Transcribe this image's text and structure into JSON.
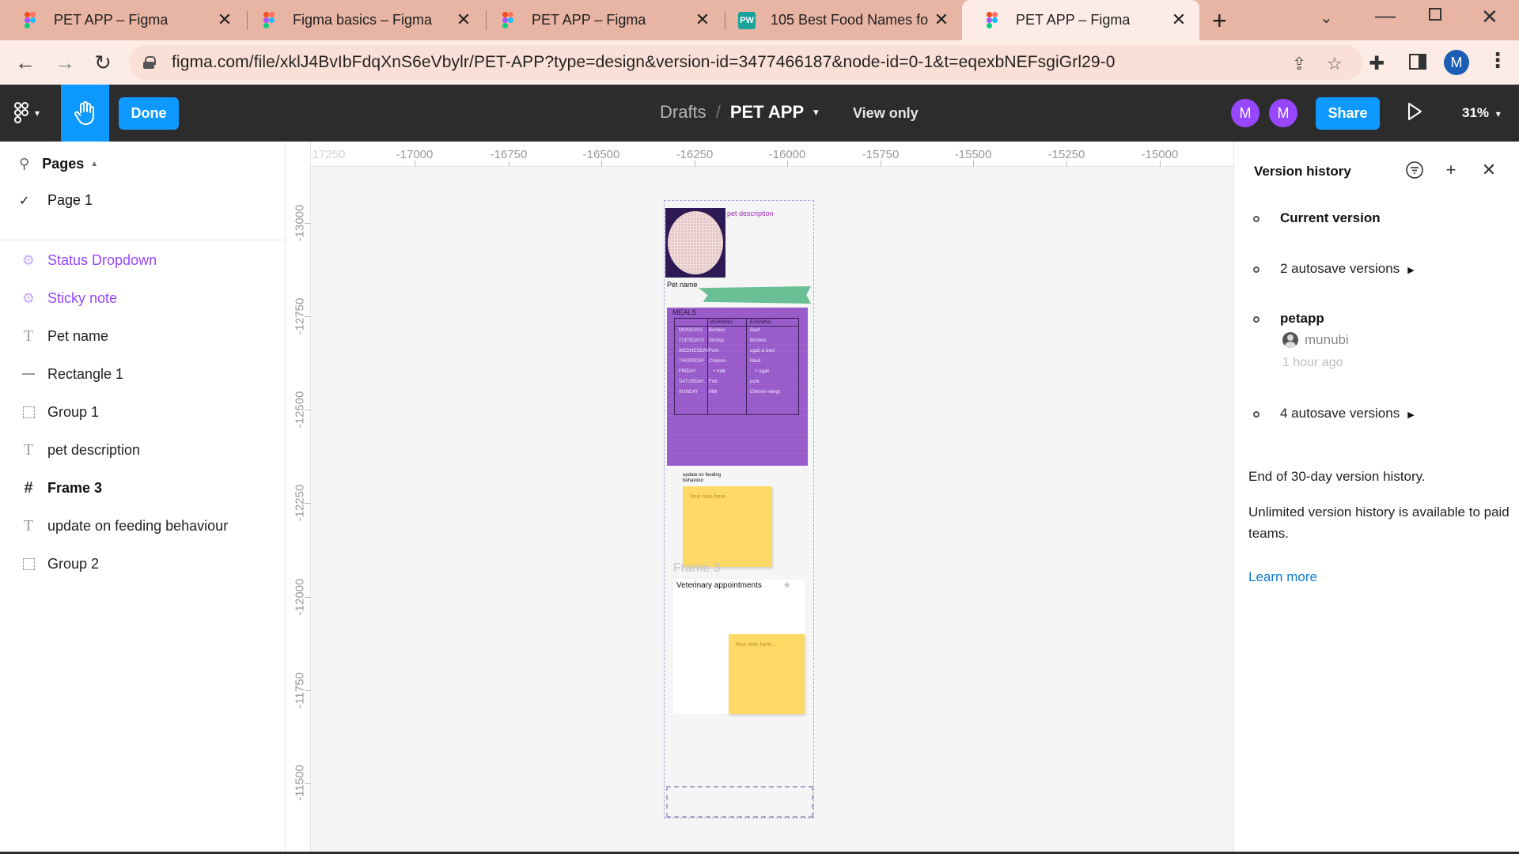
{
  "browser": {
    "tabs": [
      {
        "label": "PET APP – Figma",
        "icon": "figma-icon"
      },
      {
        "label": "Figma basics – Figma",
        "icon": "figma-icon"
      },
      {
        "label": "PET APP – Figma",
        "icon": "figma-icon"
      },
      {
        "label": "105 Best Food Names for",
        "icon": "pw-icon",
        "icon_text": "PW"
      },
      {
        "label": "PET APP – Figma",
        "icon": "figma-icon",
        "active": true
      }
    ],
    "url": "figma.com/file/xklJ4BvIbFdqXnS6eVbylr/PET-APP?type=design&version-id=3477466187&node-id=0-1&t=eqexbNEFsgiGrl29-0",
    "profile_initial": "M",
    "colors": {
      "tabbar": "#e8b4a3",
      "toolbar": "#fdece6"
    }
  },
  "figma_toolbar": {
    "done_label": "Done",
    "breadcrumb_drafts": "Drafts",
    "breadcrumb_sep": "/",
    "file_name": "PET APP",
    "view_only": "View only",
    "avatars": [
      "M",
      "M"
    ],
    "share_label": "Share",
    "zoom": "31%",
    "accent": "#0d99ff",
    "avatar_color": "#9747ff"
  },
  "left_panel": {
    "pages_label": "Pages",
    "current_page": "Page 1",
    "layers": [
      {
        "label": "Status Dropdown",
        "type": "component"
      },
      {
        "label": "Sticky note",
        "type": "component"
      },
      {
        "label": "Pet name",
        "type": "text"
      },
      {
        "label": "Rectangle 1",
        "type": "rectangle"
      },
      {
        "label": "Group 1",
        "type": "group"
      },
      {
        "label": "pet description",
        "type": "text"
      },
      {
        "label": "Frame 3",
        "type": "frame"
      },
      {
        "label": "update on feeding behaviour",
        "type": "text"
      },
      {
        "label": "Group 2",
        "type": "group"
      }
    ]
  },
  "canvas": {
    "ruler_x": [
      "-17250",
      "-17000",
      "-16750",
      "-16500",
      "-16250",
      "-16000",
      "-15750",
      "-15500",
      "-15250",
      "-15000"
    ],
    "ruler_y": [
      "-13000",
      "-12750",
      "-12500",
      "-12250",
      "-12000",
      "-11750",
      "-11500"
    ],
    "pet_description": "pet description",
    "pet_name": "Pet name",
    "meals_title": "MEALS",
    "meals_headers": [
      "MORNING",
      "EVENING"
    ],
    "meals_rows": [
      {
        "day": "MONDAYS",
        "morning": "Bonbon",
        "evening": "Beef"
      },
      {
        "day": "TUESDAYS",
        "morning": "Shrimp",
        "evening": "Bonbon"
      },
      {
        "day": "WEDNESDAY",
        "morning": "Pork",
        "evening": "ugali & beef"
      },
      {
        "day": "THURSDAY",
        "morning": "Chicken",
        "evening": "Meat"
      },
      {
        "day": "FRIDAY",
        "morning": "+ milk",
        "evening": "+ ugali"
      },
      {
        "day": "SATURDAY",
        "morning": "Fish",
        "evening": "pork"
      },
      {
        "day": "SUNDAY",
        "morning": "Milk",
        "evening": "Chicken wings"
      }
    ],
    "feeding_label": "update on feeding behaviour",
    "sticky_placeholder": "Your note here...",
    "frame_label": "Frame 3",
    "vet_title": "Veterinary appointments"
  },
  "version_history": {
    "title": "Version history",
    "entries": [
      {
        "label": "Current version"
      },
      {
        "label": "2 autosave versions"
      },
      {
        "label": "petapp",
        "user": "munubi",
        "time": "1 hour ago"
      },
      {
        "label": "4 autosave versions"
      }
    ],
    "end_note": "End of 30-day version history.",
    "unlimited_note": "Unlimited version history is available to paid teams.",
    "learn_more": "Learn more"
  },
  "help_label": "?"
}
